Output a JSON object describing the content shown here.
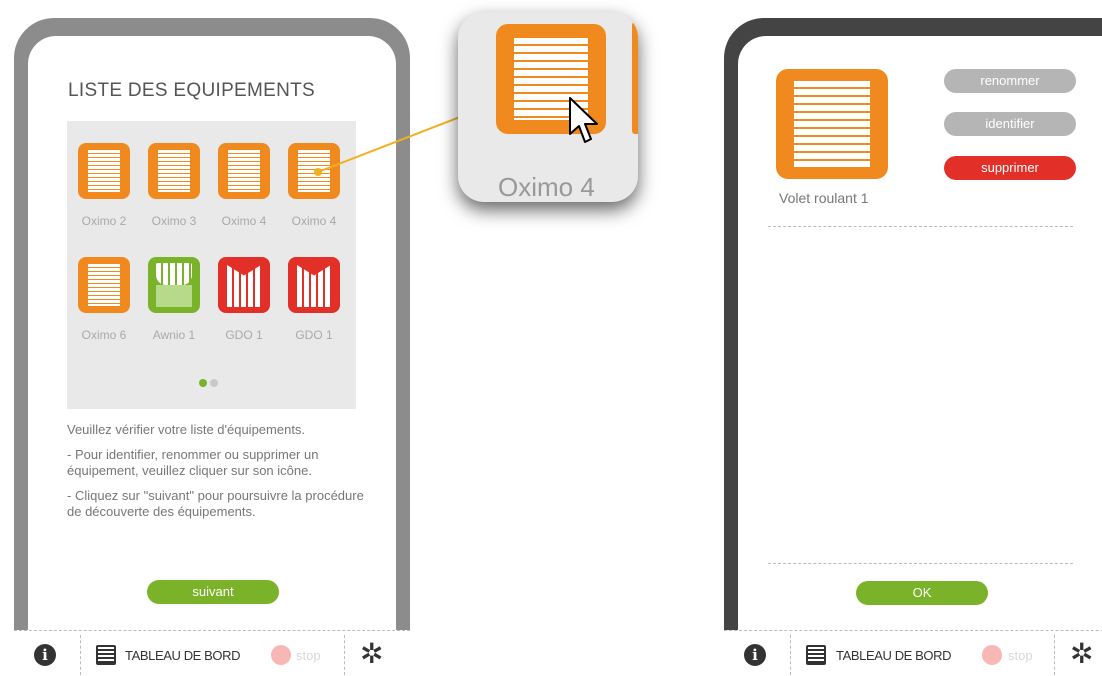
{
  "left_screen": {
    "title": "LISTE DES EQUIPEMENTS",
    "equipments": [
      {
        "label": "Oximo 2",
        "type": "roller-shutter",
        "color": "#f08a1e"
      },
      {
        "label": "Oximo 3",
        "type": "roller-shutter",
        "color": "#f08a1e"
      },
      {
        "label": "Oximo 4",
        "type": "roller-shutter",
        "color": "#f08a1e"
      },
      {
        "label": "Oximo 4",
        "type": "roller-shutter",
        "color": "#f08a1e"
      },
      {
        "label": "Oximo 6",
        "type": "roller-shutter",
        "color": "#f08a1e"
      },
      {
        "label": "Awnio 1",
        "type": "awning",
        "color": "#7ab22a"
      },
      {
        "label": "GDO 1",
        "type": "garage-door",
        "color": "#e23029"
      },
      {
        "label": "GDO 1",
        "type": "garage-door",
        "color": "#e23029"
      }
    ],
    "pagination": {
      "pages": 2,
      "current": 1
    },
    "help": [
      "Veuillez vérifier votre liste d'équipements.",
      "- Pour identifier, renommer ou supprimer un équipement, veuillez cliquer sur son icône.",
      "- Cliquez sur \"suivant\" pour poursuivre la procédure de découverte des équipements."
    ],
    "next_label": "suivant"
  },
  "zoom": {
    "label": "Oximo 4"
  },
  "right_screen": {
    "device_name": "Volet roulant 1",
    "rename_label": "renommer",
    "identify_label": "identifier",
    "delete_label": "supprimer",
    "ok_label": "OK"
  },
  "bottom_bar": {
    "info": "i",
    "dashboard_label": "TABLEAU DE BORD",
    "stop_label": "stop",
    "gear": "✲"
  },
  "colors": {
    "orange": "#f08a1e",
    "green": "#7ab22a",
    "red": "#e23029",
    "frame_left": "#8c8c8c",
    "frame_right": "#444444"
  }
}
